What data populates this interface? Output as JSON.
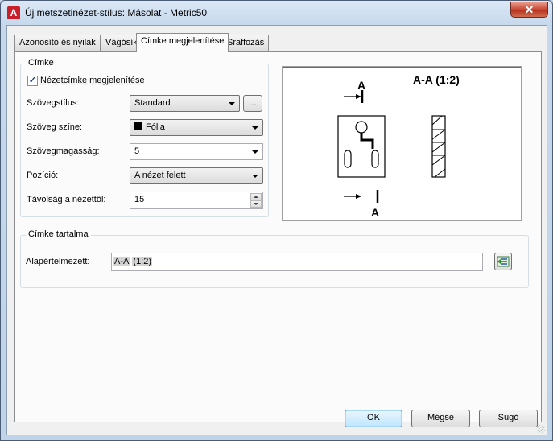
{
  "window": {
    "title": "Új metszetinézet-stílus: Másolat - Metric50",
    "close_glyph": "✕",
    "app_icon_letter": "A"
  },
  "tabs": [
    {
      "label": "Azonosító és nyilak",
      "active": false
    },
    {
      "label": "Vágósík",
      "active": false
    },
    {
      "label": "Címke megjelenítése",
      "active": true
    },
    {
      "label": "Sraffozás",
      "active": false
    }
  ],
  "label_group": {
    "title": "Címke",
    "show_label_checkbox": {
      "label": "Nézetcímke megjelenítése",
      "checked": true,
      "check_glyph": "✓"
    },
    "text_style": {
      "label": "Szövegstílus:",
      "value": "Standard",
      "browse_label": "..."
    },
    "text_color": {
      "label": "Szöveg színe:",
      "value": "Fólia",
      "swatch_color": "#000000"
    },
    "text_height": {
      "label": "Szövegmagasság:",
      "value": "5"
    },
    "position": {
      "label": "Pozíció:",
      "value": "A nézet felett"
    },
    "distance": {
      "label": "Távolság a nézettől:",
      "value": "15"
    }
  },
  "preview": {
    "title": "A-A (1:2)",
    "top_marker": "A",
    "bottom_marker": "A"
  },
  "content_group": {
    "title": "Címke tartalma",
    "default_label": "Alapértelmezett:",
    "tokens": [
      "A-A",
      "(1:2)"
    ],
    "editor_icon": "field-editor-icon"
  },
  "footer": {
    "ok": "OK",
    "cancel": "Mégse",
    "help": "Súgó"
  },
  "colors": {
    "accent": "#3c7fb1",
    "close": "#c74632",
    "app_icon": "#c8202a"
  }
}
